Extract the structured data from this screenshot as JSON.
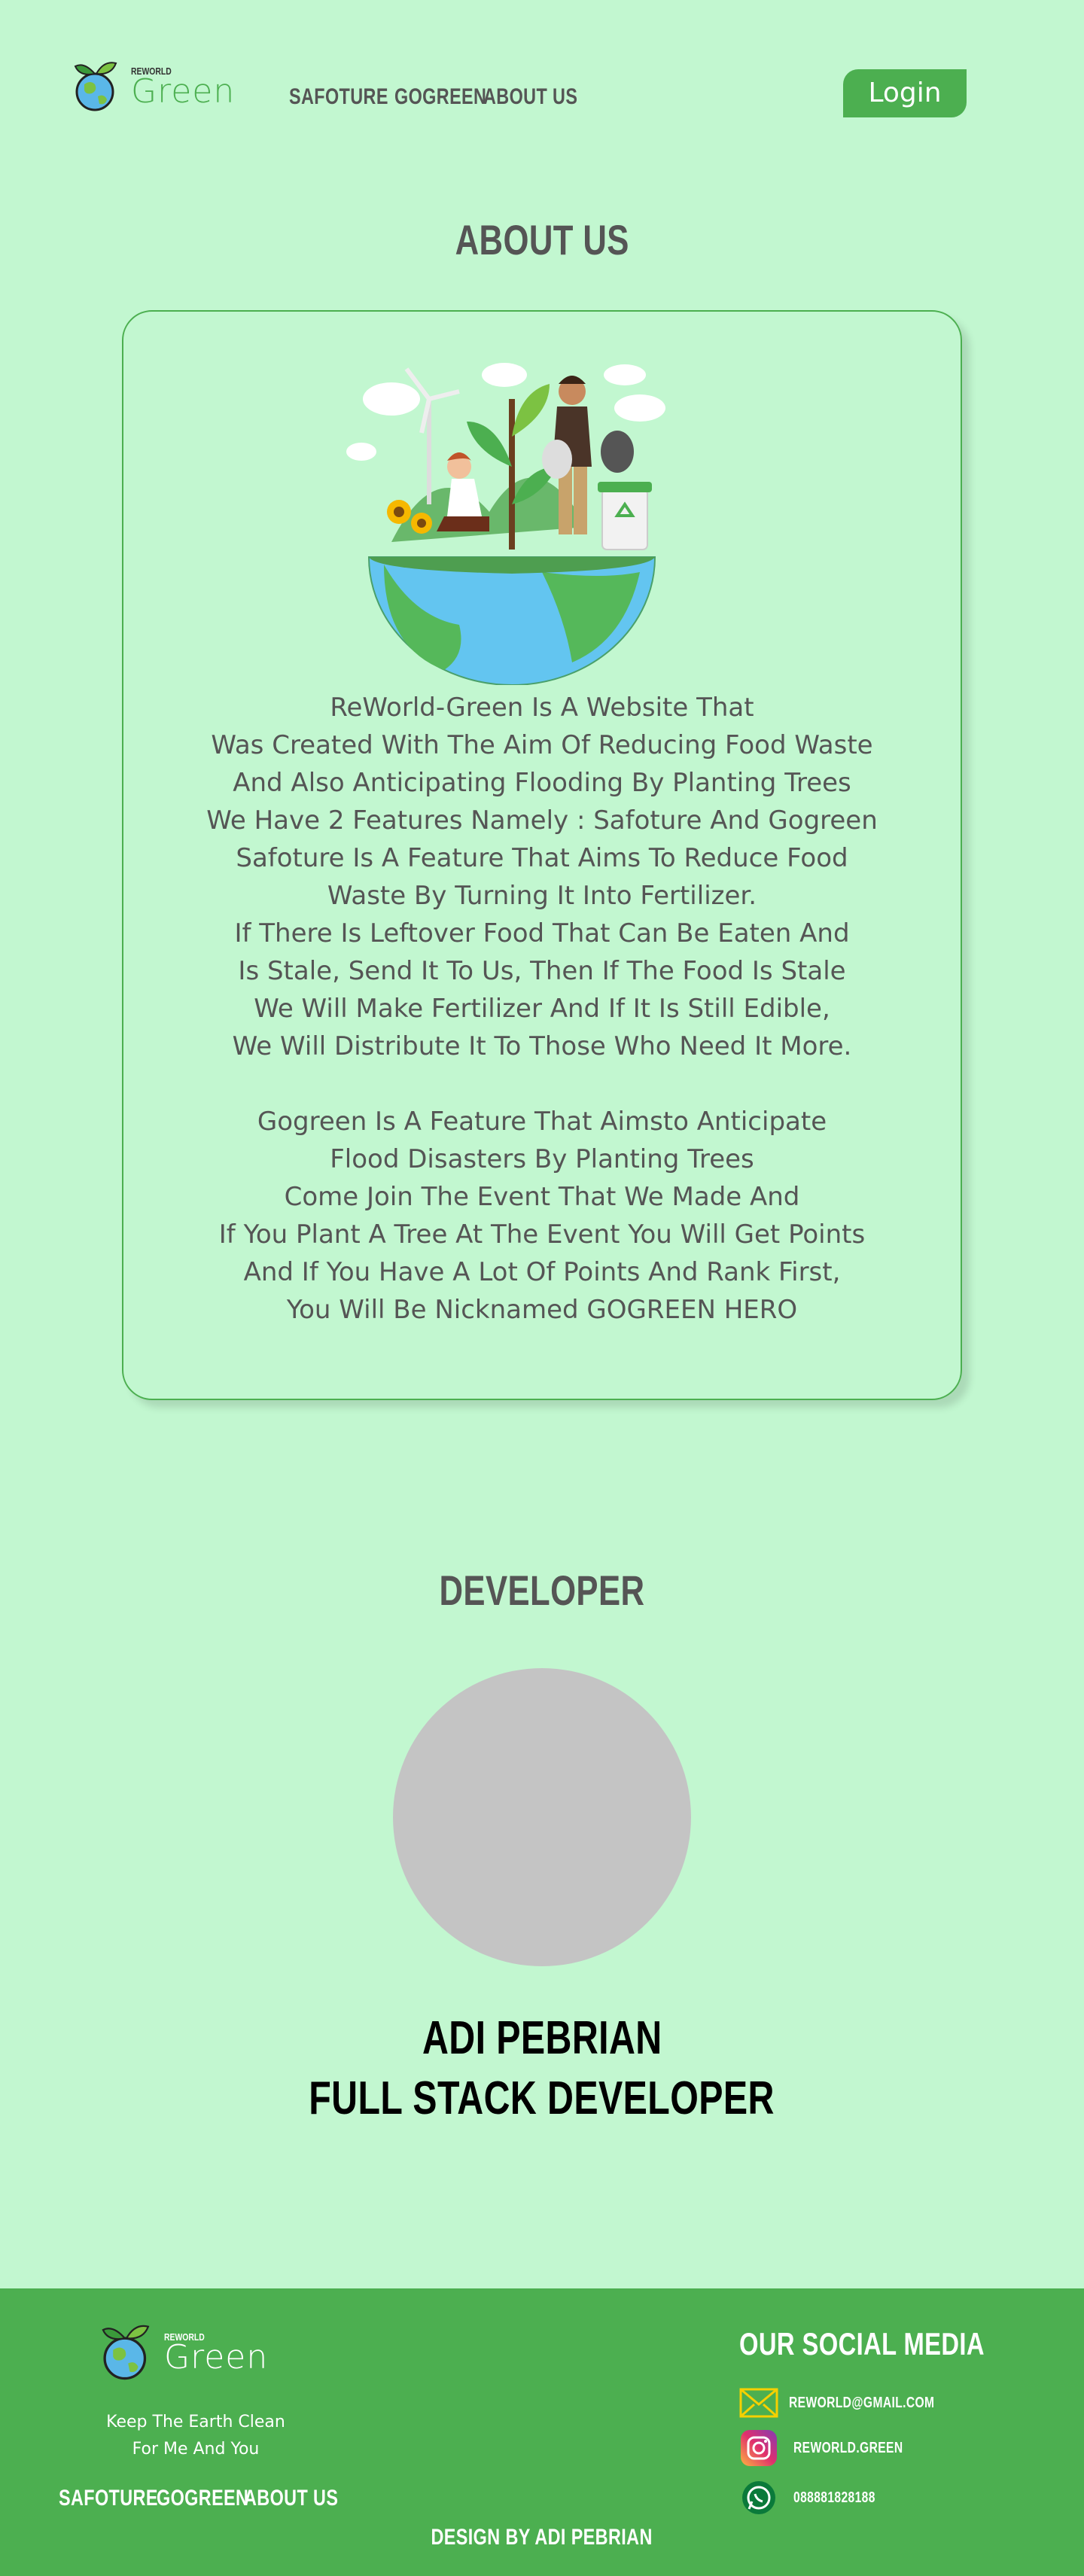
{
  "header": {
    "logo_small": "REWORLD",
    "logo_big": "Green",
    "nav": [
      "SAFOTURE",
      "GOGREEN",
      "ABOUT US"
    ],
    "login_label": "Login"
  },
  "about": {
    "title": "ABOUT US",
    "paragraph1": [
      "ReWorld-Green Is A Website That",
      "Was Created With The Aim Of Reducing Food Waste",
      "And Also Anticipating Flooding By Planting Trees",
      "We Have 2 Features Namely : Safoture And Gogreen",
      "Safoture Is A Feature That Aims To Reduce Food",
      "Waste By Turning It Into Fertilizer.",
      "If There Is Leftover Food That Can Be Eaten And",
      "Is Stale, Send It To Us, Then If The Food Is Stale",
      "We Will Make Fertilizer And If It Is Still Edible,",
      "We Will Distribute It To Those Who Need It More."
    ],
    "paragraph2": [
      "Gogreen Is A Feature That Aimsto Anticipate",
      "Flood Disasters By Planting Trees",
      "Come Join The Event That We Made And",
      "If You Plant A Tree At The Event You Will Get Points",
      "And If You Have A Lot Of Points And Rank First,",
      "You Will Be Nicknamed GOGREEN HERO"
    ]
  },
  "developer": {
    "title": "DEVELOPER",
    "name": "ADI PEBRIAN",
    "role": "FULL STACK DEVELOPER"
  },
  "footer": {
    "logo_small": "REWORLD",
    "logo_big": "Green",
    "tagline_line1": "Keep The Earth Clean",
    "tagline_line2": "For Me And You",
    "nav": [
      "SAFOTURE",
      "GOGREEN",
      "ABOUT US"
    ],
    "design_credit": "DESIGN BY ADI PEBRIAN",
    "social_title": "OUR SOCIAL MEDIA",
    "social": [
      {
        "icon": "mail-icon",
        "label": "REWORLD@GMAIL.COM"
      },
      {
        "icon": "instagram-icon",
        "label": "REWORLD.GREEN"
      },
      {
        "icon": "whatsapp-icon",
        "label": "088881828188"
      }
    ]
  },
  "colors": {
    "background": "#c2f7d0",
    "accent": "#4caf50",
    "text": "#555555",
    "avatar_placeholder": "#c4c4c4"
  }
}
